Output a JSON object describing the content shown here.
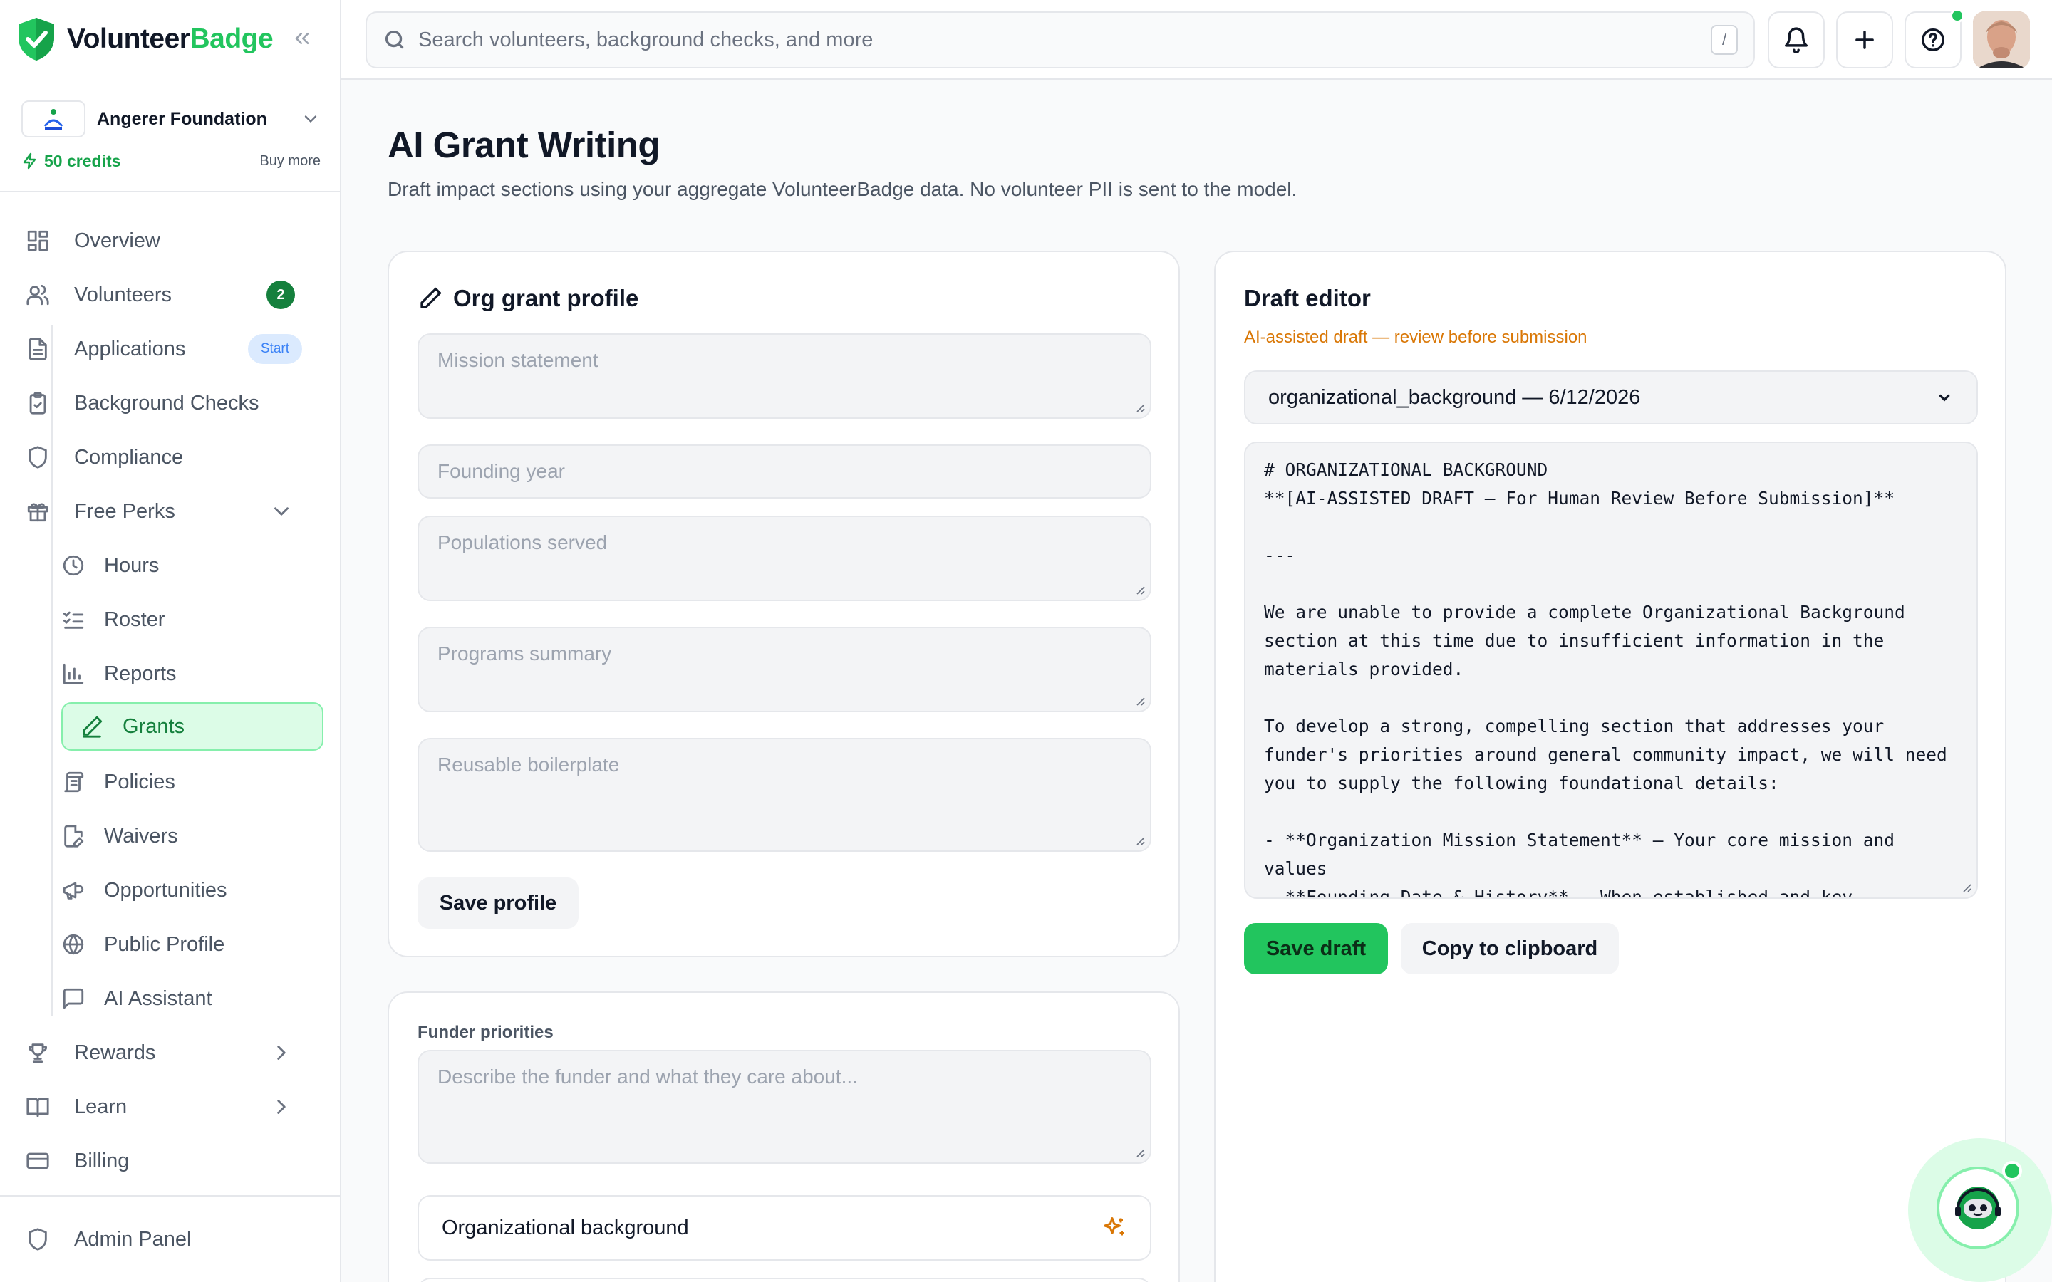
{
  "brand": {
    "name_part1": "Volunteer",
    "name_part2": "Badge"
  },
  "org": {
    "name": "Angerer Foundation",
    "credits": "50 credits",
    "buy_more": "Buy more"
  },
  "nav": {
    "overview": "Overview",
    "volunteers": "Volunteers",
    "volunteers_badge": "2",
    "applications": "Applications",
    "applications_badge": "Start",
    "background_checks": "Background Checks",
    "compliance": "Compliance",
    "free_perks": "Free Perks",
    "hours": "Hours",
    "roster": "Roster",
    "reports": "Reports",
    "grants": "Grants",
    "policies": "Policies",
    "waivers": "Waivers",
    "opportunities": "Opportunities",
    "public_profile": "Public Profile",
    "ai_assistant": "AI Assistant",
    "rewards": "Rewards",
    "learn": "Learn",
    "billing": "Billing",
    "admin_panel": "Admin Panel"
  },
  "search": {
    "placeholder": "Search volunteers, background checks, and more",
    "shortcut": "/"
  },
  "page": {
    "title": "AI Grant Writing",
    "subtitle": "Draft impact sections using your aggregate VolunteerBadge data. No volunteer PII is sent to the model."
  },
  "profile_card": {
    "title": "Org grant profile",
    "mission_placeholder": "Mission statement",
    "founding_placeholder": "Founding year",
    "populations_placeholder": "Populations served",
    "programs_placeholder": "Programs summary",
    "boilerplate_placeholder": "Reusable boilerplate",
    "save_button": "Save profile"
  },
  "funder_card": {
    "label": "Funder priorities",
    "placeholder": "Describe the funder and what they care about...",
    "section_option": "Organizational background"
  },
  "draft_card": {
    "title": "Draft editor",
    "warning": "AI-assisted draft — review before submission",
    "selected_draft": "organizational_background — 6/12/2026",
    "content": "# ORGANIZATIONAL BACKGROUND\n**[AI-ASSISTED DRAFT – For Human Review Before Submission]**\n\n---\n\nWe are unable to provide a complete Organizational Background section at this time due to insufficient information in the materials provided.\n\nTo develop a strong, compelling section that addresses your funder's priorities around general community impact, we will need you to supply the following foundational details:\n\n- **Organization Mission Statement** – Your core mission and values\n- **Founding Date & History** – When established and key",
    "save_button": "Save draft",
    "copy_button": "Copy to clipboard"
  },
  "colors": {
    "accent": "#22c55e",
    "accent_dark": "#15803d",
    "warning": "#d97706"
  }
}
